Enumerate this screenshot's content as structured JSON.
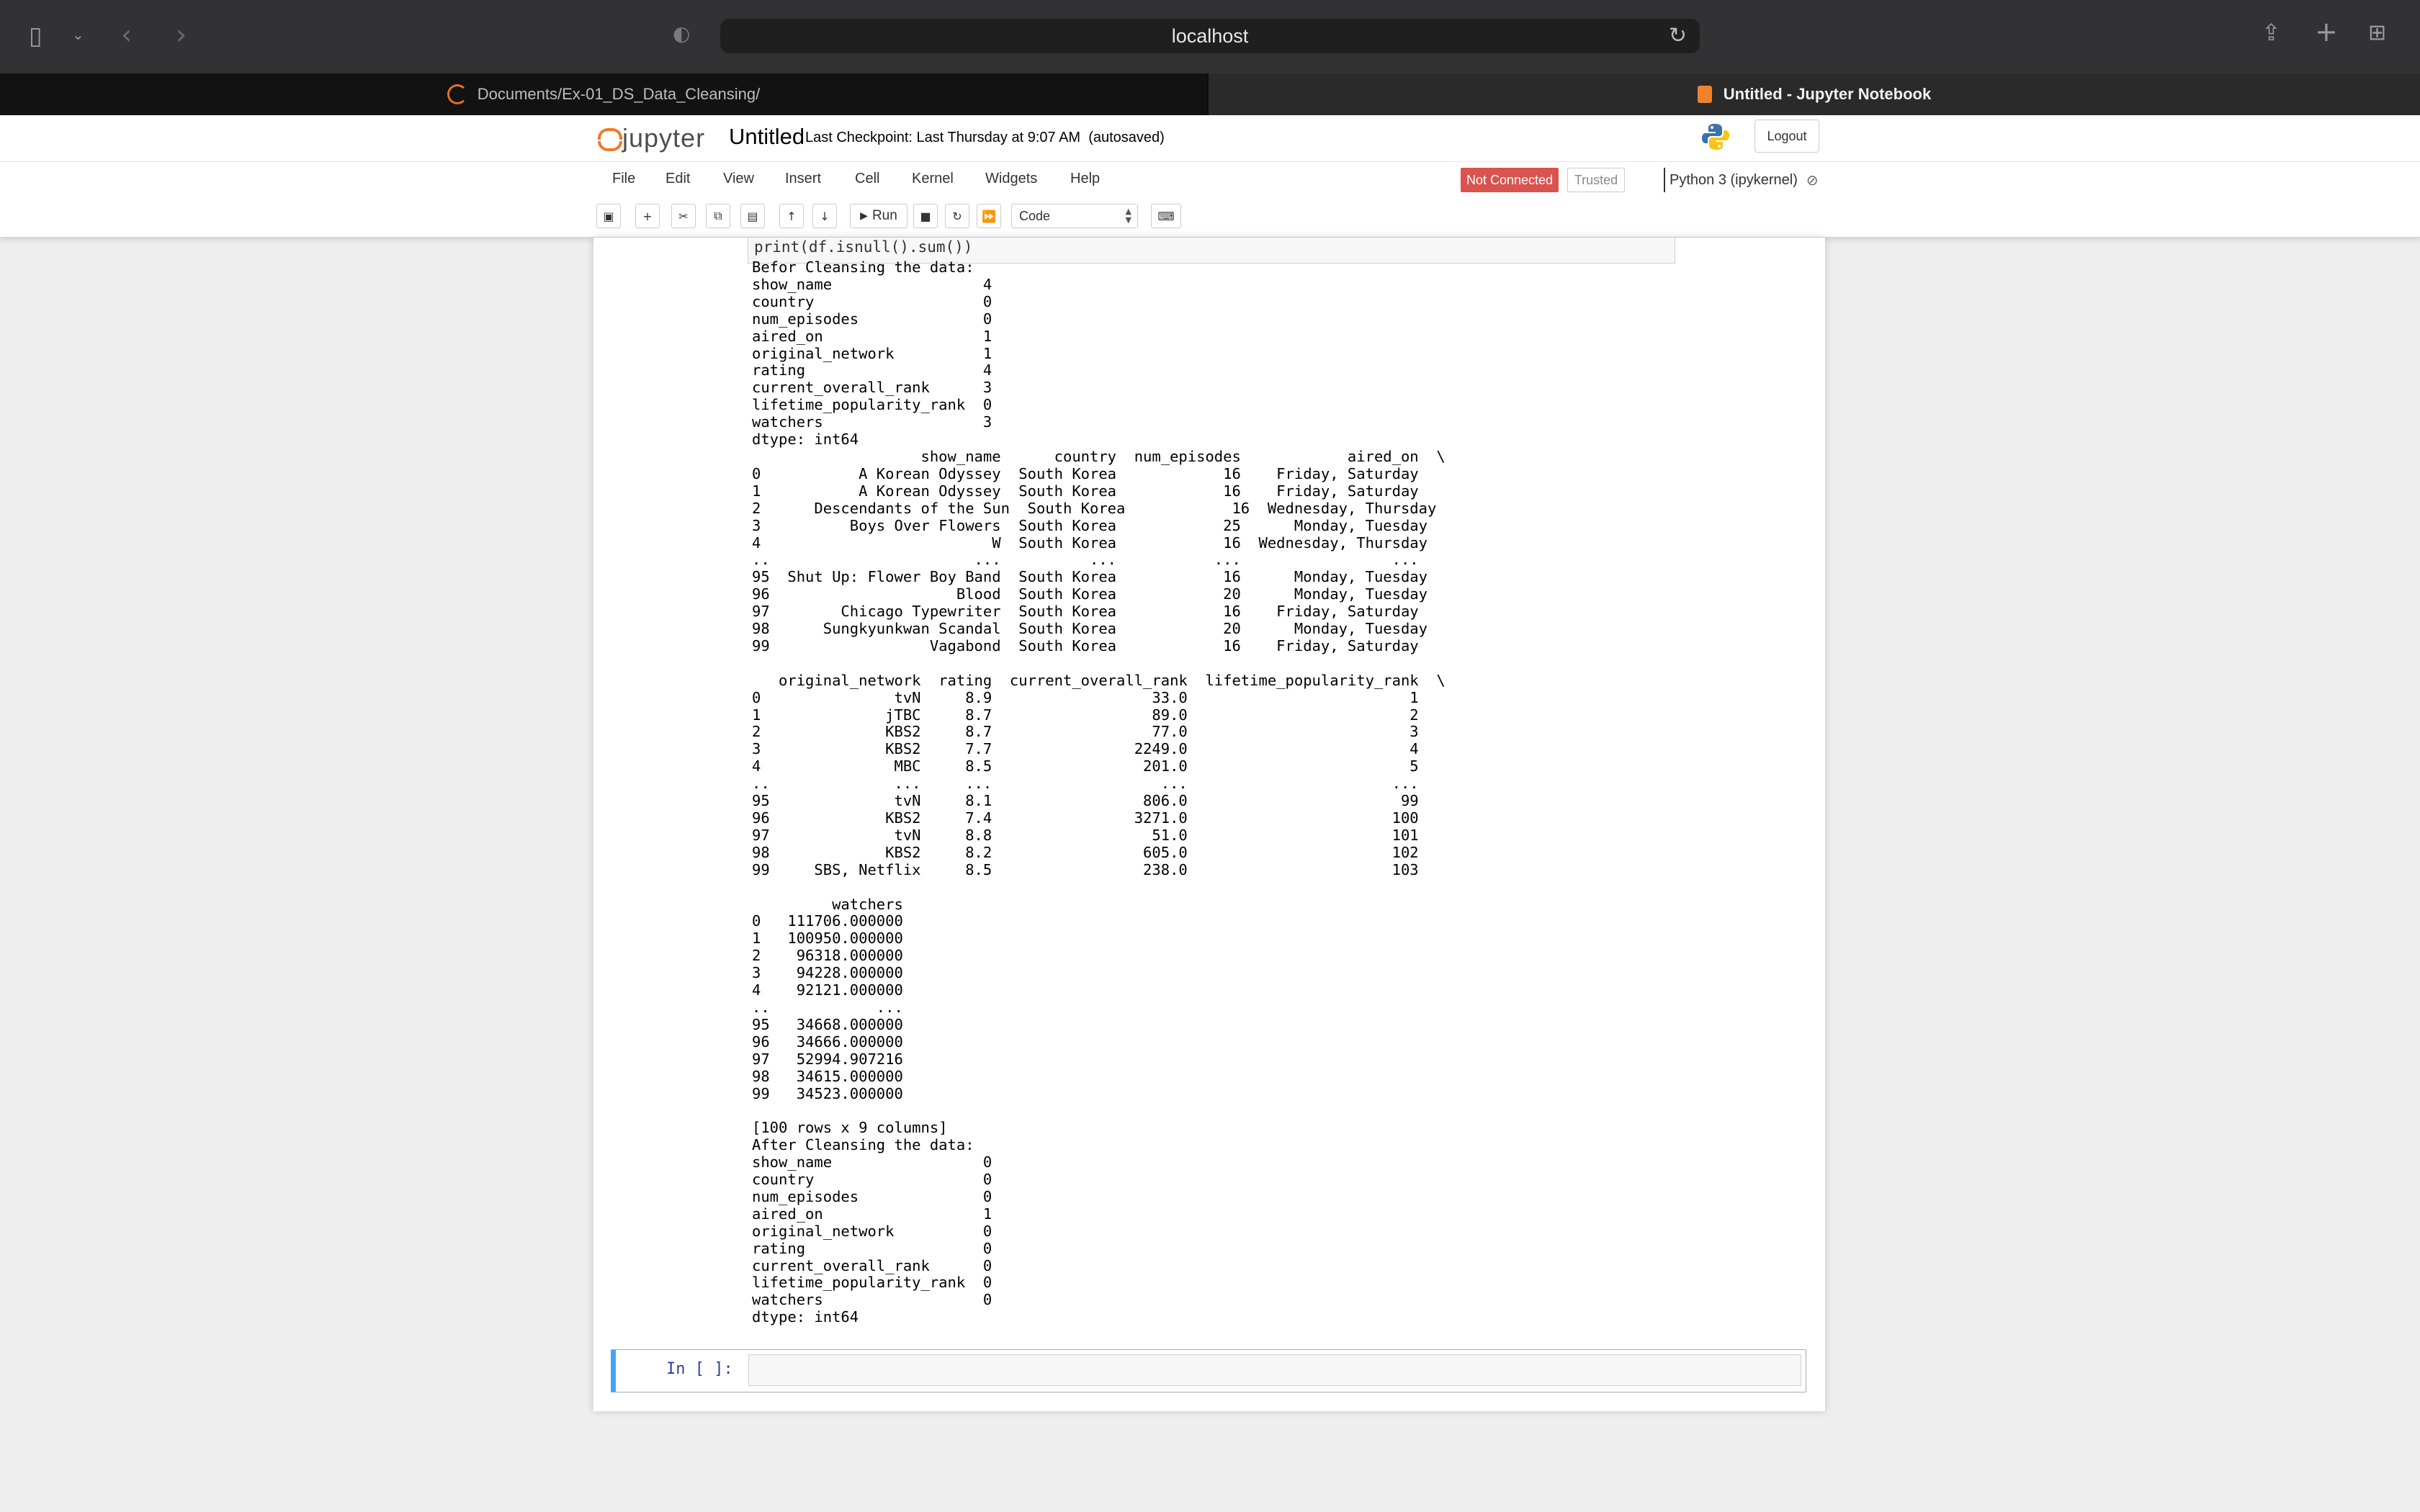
{
  "browser": {
    "url": "localhost",
    "tabs": [
      {
        "label": "Documents/Ex-01_DS_Data_Cleansing/"
      },
      {
        "label": "Untitled - Jupyter Notebook"
      }
    ]
  },
  "header": {
    "logo_text": "jupyter",
    "notebook_name": "Untitled",
    "checkpoint": "Last Checkpoint: Last Thursday at 9:07 AM",
    "autosave": "(autosaved)",
    "logout_label": "Logout"
  },
  "menu": {
    "items": [
      "File",
      "Edit",
      "View",
      "Insert",
      "Cell",
      "Kernel",
      "Widgets",
      "Help"
    ],
    "kernel_status": "Not Connected",
    "trusted": "Trusted",
    "kernel_name": "Python 3 (ipykernel)"
  },
  "toolbar": {
    "run_label": "Run",
    "cell_type": "Code"
  },
  "cells": {
    "previous_code": "print(df.isnull().sum())",
    "output_lines": [
      "Befor Cleansing the data:",
      "show_name                 4",
      "country                   0",
      "num_episodes              0",
      "aired_on                  1",
      "original_network          1",
      "rating                    4",
      "current_overall_rank      3",
      "lifetime_popularity_rank  0",
      "watchers                  3",
      "dtype: int64",
      "                   show_name      country  num_episodes            aired_on  \\",
      "0           A Korean Odyssey  South Korea            16    Friday, Saturday",
      "1           A Korean Odyssey  South Korea            16    Friday, Saturday",
      "2      Descendants of the Sun  South Korea            16  Wednesday, Thursday",
      "3          Boys Over Flowers  South Korea            25      Monday, Tuesday",
      "4                          W  South Korea            16  Wednesday, Thursday",
      "..                       ...          ...           ...                 ...",
      "95  Shut Up: Flower Boy Band  South Korea            16      Monday, Tuesday",
      "96                     Blood  South Korea            20      Monday, Tuesday",
      "97        Chicago Typewriter  South Korea            16    Friday, Saturday",
      "98      Sungkyunkwan Scandal  South Korea            20      Monday, Tuesday",
      "99                  Vagabond  South Korea            16    Friday, Saturday",
      "",
      "   original_network  rating  current_overall_rank  lifetime_popularity_rank  \\",
      "0               tvN     8.9                  33.0                         1",
      "1              jTBC     8.7                  89.0                         2",
      "2              KBS2     8.7                  77.0                         3",
      "3              KBS2     7.7                2249.0                         4",
      "4               MBC     8.5                 201.0                         5",
      "..              ...     ...                   ...                       ...",
      "95              tvN     8.1                 806.0                        99",
      "96             KBS2     7.4                3271.0                       100",
      "97              tvN     8.8                  51.0                       101",
      "98             KBS2     8.2                 605.0                       102",
      "99     SBS, Netflix     8.5                 238.0                       103",
      "",
      "         watchers",
      "0   111706.000000",
      "1   100950.000000",
      "2    96318.000000",
      "3    94228.000000",
      "4    92121.000000",
      "..            ...",
      "95   34668.000000",
      "96   34666.000000",
      "97   52994.907216",
      "98   34615.000000",
      "99   34523.000000",
      "",
      "[100 rows x 9 columns]",
      "After Cleansing the data:",
      "show_name                 0",
      "country                   0",
      "num_episodes              0",
      "aired_on                  1",
      "original_network          0",
      "rating                    0",
      "current_overall_rank      0",
      "lifetime_popularity_rank  0",
      "watchers                  0",
      "dtype: int64"
    ],
    "empty_prompt": "In [ ]:"
  }
}
